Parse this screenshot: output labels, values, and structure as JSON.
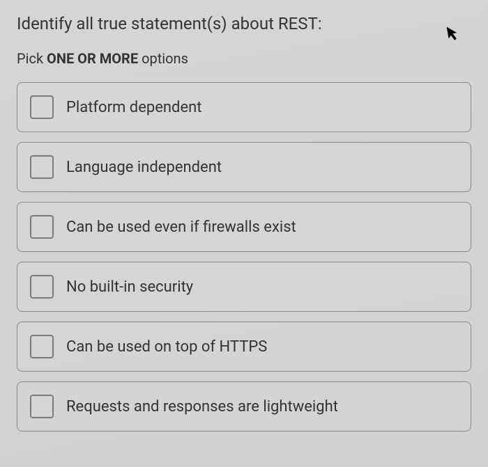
{
  "question": {
    "title": "Identify all true statement(s) about REST:",
    "instruction_prefix": "Pick ",
    "instruction_bold": "ONE OR MORE",
    "instruction_suffix": " options"
  },
  "options": [
    {
      "label": "Platform dependent"
    },
    {
      "label": "Language independent"
    },
    {
      "label": "Can be used even if firewalls exist"
    },
    {
      "label": "No built-in security"
    },
    {
      "label": "Can be used on top of HTTPS"
    },
    {
      "label": "Requests and responses are lightweight"
    }
  ]
}
